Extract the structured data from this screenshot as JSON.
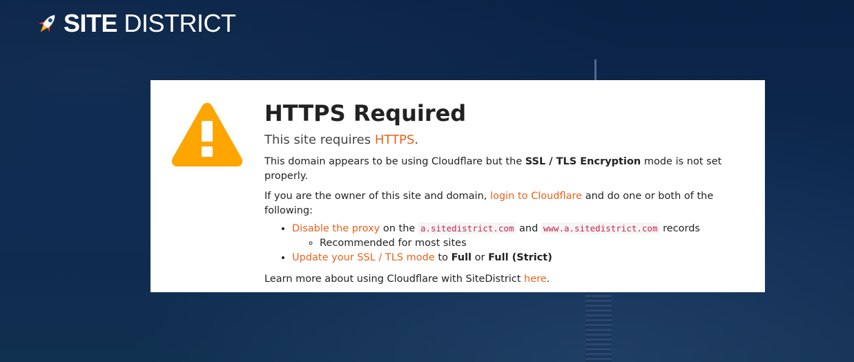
{
  "brand": {
    "bold": "SITE",
    "light": "DISTRICT"
  },
  "notice": {
    "title": "HTTPS Required",
    "subtitle_prefix": "This site requires ",
    "subtitle_link": "HTTPS",
    "subtitle_suffix": ".",
    "line1_prefix": "This domain appears to be using Cloudflare but the ",
    "line1_bold": "SSL / TLS Encryption",
    "line1_suffix": " mode is not set properly.",
    "line2_prefix": "If you are the owner of this site and domain, ",
    "line2_link": "login to Cloudflare",
    "line2_suffix": " and do one or both of the following:",
    "item1_link": "Disable the proxy",
    "item1_on": " on the ",
    "item1_code1": "a.sitedistrict.com",
    "item1_and": " and ",
    "item1_code2": "www.a.sitedistrict.com",
    "item1_suffix": " records",
    "item1_sub": "Recommended for most sites",
    "item2_link": "Update your SSL / TLS mode",
    "item2_to": " to ",
    "item2_bold1": "Full",
    "item2_or": " or ",
    "item2_bold2": "Full (Strict)",
    "learn_prefix": "Learn more about using Cloudflare with SiteDistrict ",
    "learn_link": "here",
    "learn_suffix": "."
  },
  "colors": {
    "link": "#e8631a",
    "warning": "#ffa500",
    "background": "#0b2545"
  },
  "icons": {
    "logo": "rocket-icon",
    "alert": "warning-triangle-icon"
  }
}
